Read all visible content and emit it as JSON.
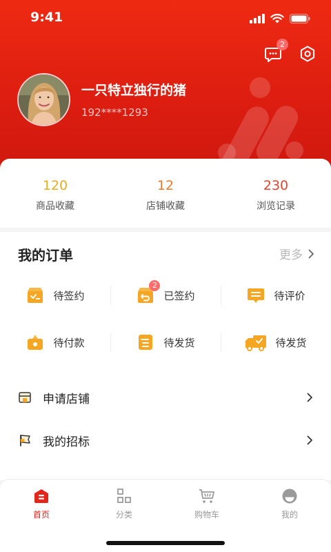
{
  "status_bar": {
    "time": "9:41"
  },
  "header": {
    "message_badge": "2"
  },
  "profile": {
    "nickname": "一只特立独行的猪",
    "phone": "192****1293"
  },
  "stats": [
    {
      "value": "120",
      "label": "商品收藏",
      "color": "#e9ad22"
    },
    {
      "value": "12",
      "label": "店铺收藏",
      "color": "#ea7b2a"
    },
    {
      "value": "230",
      "label": "浏览记录",
      "color": "#e2452f"
    }
  ],
  "orders": {
    "title": "我的订单",
    "more": "更多",
    "items": [
      {
        "label": "待签约",
        "icon": "pending-sign-icon"
      },
      {
        "label": "已签约",
        "icon": "signed-icon",
        "badge": "2"
      },
      {
        "label": "待评价",
        "icon": "pending-review-icon"
      },
      {
        "label": "待付款",
        "icon": "pending-payment-icon"
      },
      {
        "label": "待发货",
        "icon": "pending-shipment-icon"
      },
      {
        "label": "待发货",
        "icon": "delivery-truck-icon"
      }
    ]
  },
  "menu": [
    {
      "label": "申请店铺",
      "icon": "store-icon"
    },
    {
      "label": "我的招标",
      "icon": "flag-icon"
    }
  ],
  "tabbar": [
    {
      "label": "首页",
      "icon": "home-icon",
      "active": true
    },
    {
      "label": "分类",
      "icon": "category-icon"
    },
    {
      "label": "购物车",
      "icon": "cart-icon"
    },
    {
      "label": "我的",
      "icon": "profile-icon"
    }
  ],
  "colors": {
    "brand_red": "#e2261a",
    "order_icon": "#f5a623"
  }
}
